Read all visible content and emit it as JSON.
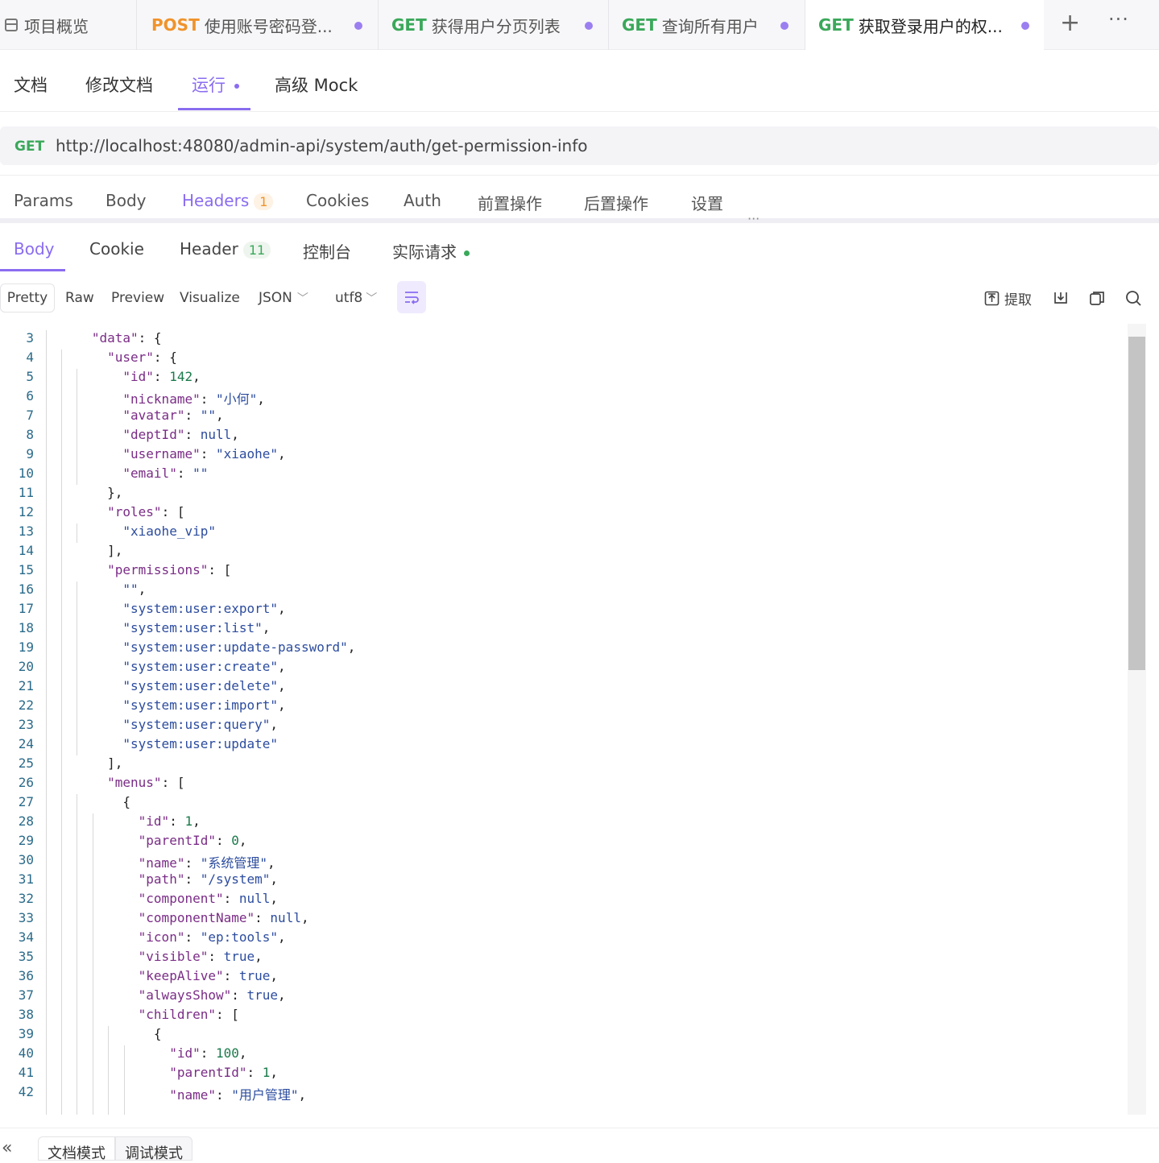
{
  "top_tabs": [
    {
      "method": "",
      "label": "项目概览"
    },
    {
      "method": "POST",
      "label": "使用账号密码登..."
    },
    {
      "method": "GET",
      "label": "获得用户分页列表"
    },
    {
      "method": "GET",
      "label": "查询所有用户"
    },
    {
      "method": "GET",
      "label": "获取登录用户的权..."
    }
  ],
  "doc_tabs": [
    "文档",
    "修改文档",
    "运行",
    "高级 Mock"
  ],
  "request": {
    "method": "GET",
    "url": "http://localhost:48080/admin-api/system/auth/get-permission-info"
  },
  "request_tabs": [
    "Params",
    "Body",
    "Headers",
    "Cookies",
    "Auth",
    "前置操作",
    "后置操作",
    "设置"
  ],
  "headers_count": "1",
  "response_tabs": [
    "Body",
    "Cookie",
    "Header",
    "控制台",
    "实际请求"
  ],
  "response_header_count": "11",
  "view_modes": [
    "Pretty",
    "Raw",
    "Preview",
    "Visualize"
  ],
  "format": "JSON",
  "encoding": "utf8",
  "extract_label": "提取",
  "footer_tabs": [
    "文档模式",
    "调试模式"
  ],
  "code_first_line": 3,
  "code_lines": [
    "  \"data\": {",
    "    \"user\": {",
    "      \"id\": 142,",
    "      \"nickname\": \"小何\",",
    "      \"avatar\": \"\",",
    "      \"deptId\": null,",
    "      \"username\": \"xiaohe\",",
    "      \"email\": \"\"",
    "    },",
    "    \"roles\": [",
    "      \"xiaohe_vip\"",
    "    ],",
    "    \"permissions\": [",
    "      \"\",",
    "      \"system:user:export\",",
    "      \"system:user:list\",",
    "      \"system:user:update-password\",",
    "      \"system:user:create\",",
    "      \"system:user:delete\",",
    "      \"system:user:import\",",
    "      \"system:user:query\",",
    "      \"system:user:update\"",
    "    ],",
    "    \"menus\": [",
    "      {",
    "        \"id\": 1,",
    "        \"parentId\": 0,",
    "        \"name\": \"系统管理\",",
    "        \"path\": \"/system\",",
    "        \"component\": null,",
    "        \"componentName\": null,",
    "        \"icon\": \"ep:tools\",",
    "        \"visible\": true,",
    "        \"keepAlive\": true,",
    "        \"alwaysShow\": true,",
    "        \"children\": [",
    "          {",
    "            \"id\": 100,",
    "            \"parentId\": 1,",
    "            \"name\": \"用户管理\","
  ]
}
